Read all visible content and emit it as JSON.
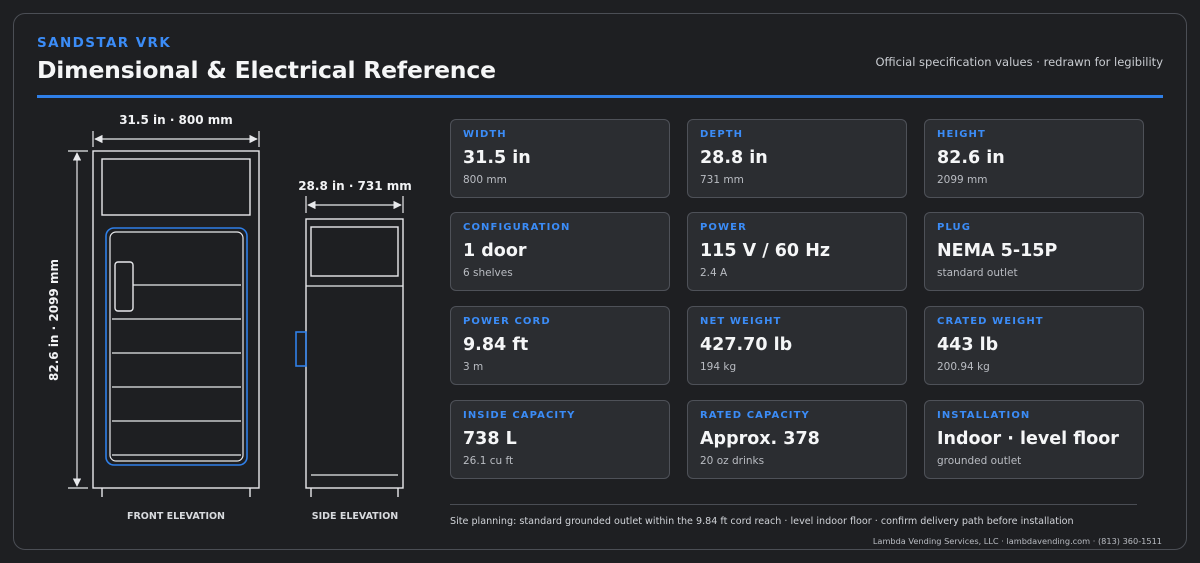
{
  "header": {
    "brand": "SANDSTAR VRK",
    "title": "Dimensional & Electrical Reference",
    "subtitle": "Official specification values · redrawn for legibility"
  },
  "drawing": {
    "front_width_label": "31.5 in · 800 mm",
    "side_depth_label": "28.8 in · 731 mm",
    "height_label": "82.6 in · 2099 mm",
    "front_caption": "FRONT ELEVATION",
    "side_caption": "SIDE ELEVATION"
  },
  "specs": [
    {
      "label": "WIDTH",
      "value": "31.5 in",
      "sub": "800 mm"
    },
    {
      "label": "DEPTH",
      "value": "28.8 in",
      "sub": "731 mm"
    },
    {
      "label": "HEIGHT",
      "value": "82.6 in",
      "sub": "2099 mm"
    },
    {
      "label": "CONFIGURATION",
      "value": "1 door",
      "sub": "6 shelves"
    },
    {
      "label": "POWER",
      "value": "115 V / 60 Hz",
      "sub": "2.4 A"
    },
    {
      "label": "PLUG",
      "value": "NEMA 5-15P",
      "sub": "standard outlet"
    },
    {
      "label": "POWER CORD",
      "value": "9.84 ft",
      "sub": "3 m"
    },
    {
      "label": "NET WEIGHT",
      "value": "427.70 lb",
      "sub": "194 kg"
    },
    {
      "label": "CRATED WEIGHT",
      "value": "443 lb",
      "sub": "200.94 kg"
    },
    {
      "label": "INSIDE CAPACITY",
      "value": "738 L",
      "sub": "26.1 cu ft"
    },
    {
      "label": "RATED CAPACITY",
      "value": "Approx. 378",
      "sub": "20 oz drinks"
    },
    {
      "label": "INSTALLATION",
      "value": "Indoor · level floor",
      "sub": "grounded outlet"
    }
  ],
  "footer": {
    "note": "Site planning: standard grounded outlet within the 9.84 ft cord reach · level indoor floor · confirm delivery path before installation",
    "company": "Lambda Vending Services, LLC · lambdavending.com · (813) 360-1511"
  },
  "colors": {
    "accent": "#3b8cf7",
    "background": "#1e1f22",
    "card": "#2b2d31",
    "line": "#e8e9ec"
  }
}
